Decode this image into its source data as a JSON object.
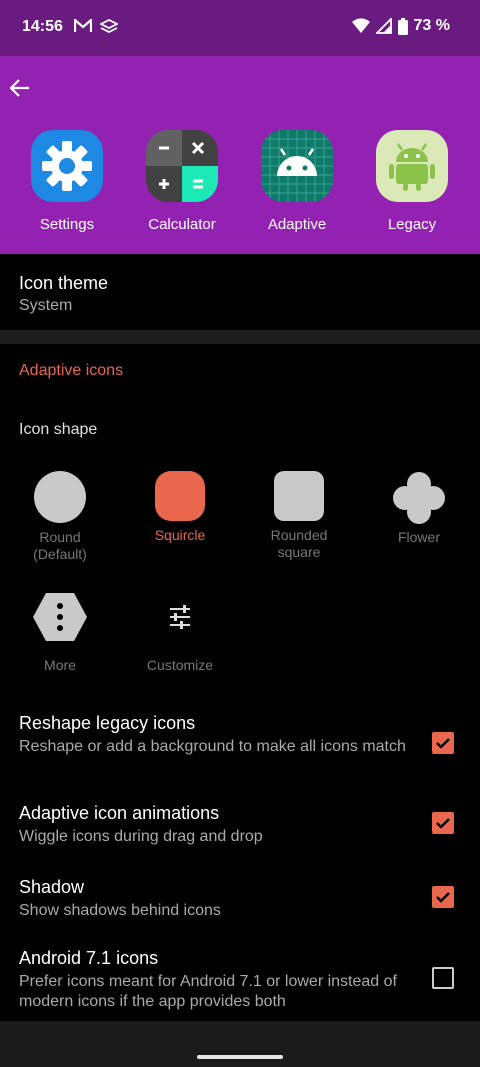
{
  "status_bar": {
    "time": "14:56",
    "battery_text": "73 %"
  },
  "preview": {
    "apps": [
      {
        "label": "Settings"
      },
      {
        "label": "Calculator"
      },
      {
        "label": "Adaptive"
      },
      {
        "label": "Legacy"
      }
    ]
  },
  "icon_theme": {
    "title": "Icon theme",
    "summary": "System"
  },
  "adaptive": {
    "section_title": "Adaptive icons",
    "icon_shape_label": "Icon shape",
    "shapes": [
      {
        "label": "Round\n(Default)",
        "selected": false
      },
      {
        "label": "Squircle",
        "selected": true
      },
      {
        "label": "Rounded\nsquare",
        "selected": false
      },
      {
        "label": "Flower",
        "selected": false
      },
      {
        "label": "More",
        "selected": false
      },
      {
        "label": "Customize",
        "selected": false
      }
    ]
  },
  "settings": [
    {
      "title": "Reshape legacy icons",
      "summary": "Reshape or add a background to make all icons match",
      "checked": true
    },
    {
      "title": "Adaptive icon animations",
      "summary": "Wiggle icons during drag and drop",
      "checked": true
    },
    {
      "title": "Shadow",
      "summary": "Show shadows behind icons",
      "checked": true
    },
    {
      "title": "Android 7.1 icons",
      "summary": "Prefer icons meant for Android 7.1 or lower instead of modern icons if the app provides both",
      "checked": false
    }
  ],
  "colors": {
    "accent": "#e8674d",
    "header": "#9322b3",
    "status_bar": "#6a1b80"
  }
}
